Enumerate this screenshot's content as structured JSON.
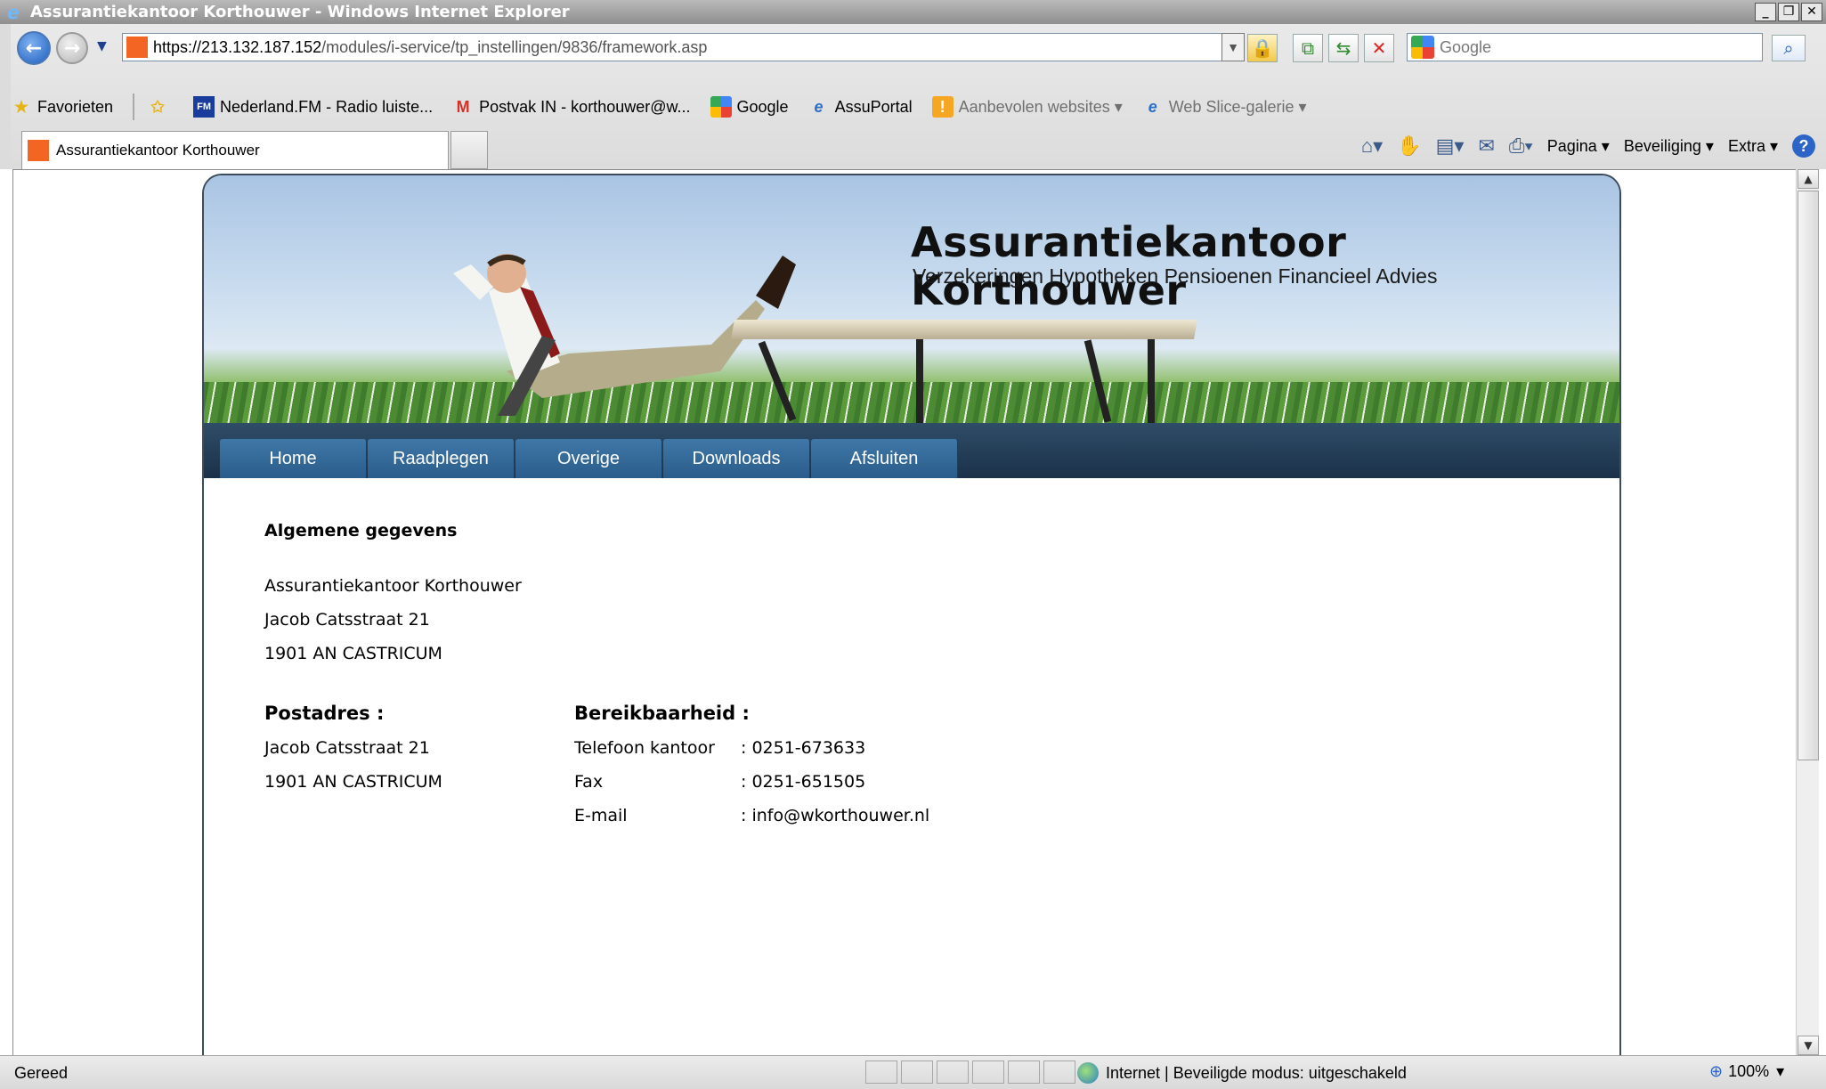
{
  "window": {
    "title": "Assurantiekantoor Korthouwer - Windows Internet Explorer",
    "controls": [
      "_",
      "❐",
      "✕"
    ]
  },
  "address": {
    "scheme": "https://",
    "host": "213.132.187.152",
    "path": "/modules/i-service/tp_instellingen/9836/framework.asp"
  },
  "search": {
    "placeholder": "Google"
  },
  "favorites": {
    "label": "Favorieten",
    "items": [
      {
        "label": "Nederland.FM - Radio luiste...",
        "icon": "fm-icon"
      },
      {
        "label": "Postvak IN - korthouwer@w...",
        "icon": "gmail-icon"
      },
      {
        "label": "Google",
        "icon": "google-icon"
      },
      {
        "label": "AssuPortal",
        "icon": "ie-page-icon"
      },
      {
        "label": "Aanbevolen websites ▾",
        "icon": "suggested-sites-icon"
      },
      {
        "label": "Web Slice-galerie ▾",
        "icon": "ie-page-icon"
      }
    ]
  },
  "tabs": [
    {
      "label": "Assurantiekantoor Korthouwer"
    }
  ],
  "commandbar": {
    "pagina": "Pagina ▾",
    "beveiliging": "Beveiliging ▾",
    "extra": "Extra ▾"
  },
  "site": {
    "title": "Assurantiekantoor Korthouwer",
    "subtitle": "Verzekeringen Hypotheken Pensioenen Financieel Advies",
    "nav": [
      "Home",
      "Raadplegen",
      "Overige",
      "Downloads",
      "Afsluiten"
    ]
  },
  "content": {
    "section_title": "Algemene gegevens",
    "company": "Assurantiekantoor Korthouwer",
    "street": "Jacob Catsstraat 21",
    "city": "1901 AN CASTRICUM",
    "postal": {
      "title": "Postadres :",
      "street": "Jacob Catsstraat 21",
      "city": "1901 AN CASTRICUM"
    },
    "reach": {
      "title": "Bereikbaarheid :",
      "rows": [
        {
          "label": "Telefoon kantoor",
          "value": ": 0251-673633"
        },
        {
          "label": "Fax",
          "value": ": 0251-651505"
        },
        {
          "label": "E-mail",
          "value": ": info@wkorthouwer.nl"
        }
      ]
    }
  },
  "status": {
    "text": "Gereed",
    "zone": "Internet | Beveiligde modus: uitgeschakeld",
    "zoom": "100%"
  }
}
